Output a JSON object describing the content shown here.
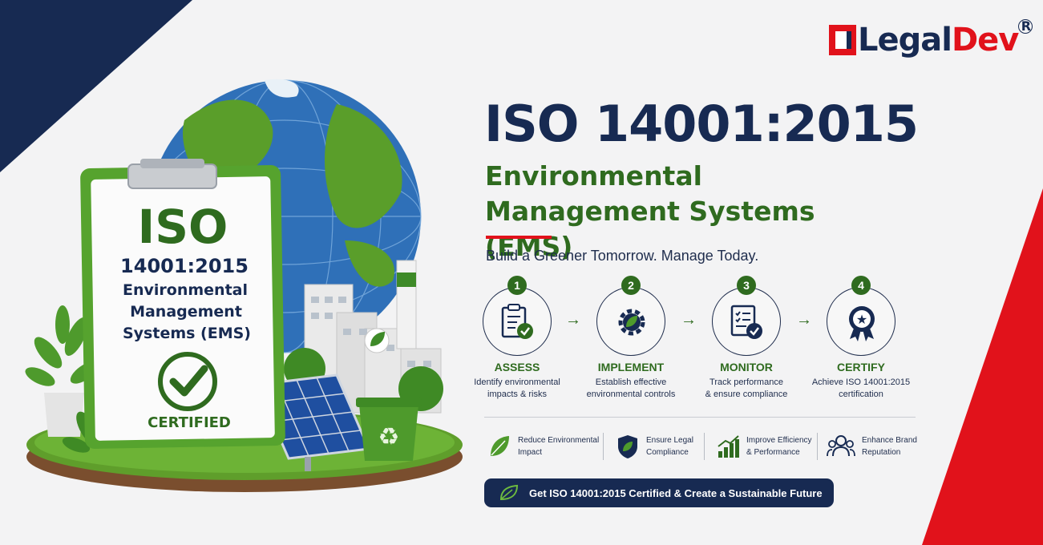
{
  "brand": {
    "name_part1": "Legal",
    "name_part2": "Dev",
    "registered": "R"
  },
  "headline": {
    "title": "ISO 14001:2015",
    "subtitle": "Environmental Management Systems (EMS)",
    "tagline": "Build a Greener Tomorrow. Manage Today."
  },
  "clipboard": {
    "line1": "ISO",
    "line2": "14001:2015",
    "line3": "Environmental",
    "line4": "Management",
    "line5": "Systems (EMS)",
    "badge": "CERTIFIED"
  },
  "steps": [
    {
      "num": "1",
      "title": "ASSESS",
      "desc1": "Identify environmental",
      "desc2": "impacts & risks",
      "icon": "checklist-icon"
    },
    {
      "num": "2",
      "title": "IMPLEMENT",
      "desc1": "Establish effective",
      "desc2": "environmental controls",
      "icon": "gear-leaf-icon"
    },
    {
      "num": "3",
      "title": "MONITOR",
      "desc1": "Track performance",
      "desc2": "& ensure compliance",
      "icon": "clipboard-check-icon"
    },
    {
      "num": "4",
      "title": "CERTIFY",
      "desc1": "Achieve ISO 14001:2015",
      "desc2": "certification",
      "icon": "award-ribbon-icon"
    }
  ],
  "benefits": [
    {
      "line1": "Reduce Environmental",
      "line2": "Impact",
      "icon": "leaf-icon"
    },
    {
      "line1": "Ensure Legal",
      "line2": "Compliance",
      "icon": "shield-leaf-icon"
    },
    {
      "line1": "Improve Efficiency",
      "line2": "& Performance",
      "icon": "growth-chart-icon"
    },
    {
      "line1": "Enhance Brand",
      "line2": "Reputation",
      "icon": "people-icon"
    }
  ],
  "cta": {
    "label": "Get ISO 14001:2015 Certified & Create a Sustainable Future",
    "icon": "leaf-badge-icon"
  },
  "colors": {
    "navy": "#172a52",
    "green": "#2f6b1f",
    "red": "#e1121b",
    "background": "#f3f3f4"
  }
}
